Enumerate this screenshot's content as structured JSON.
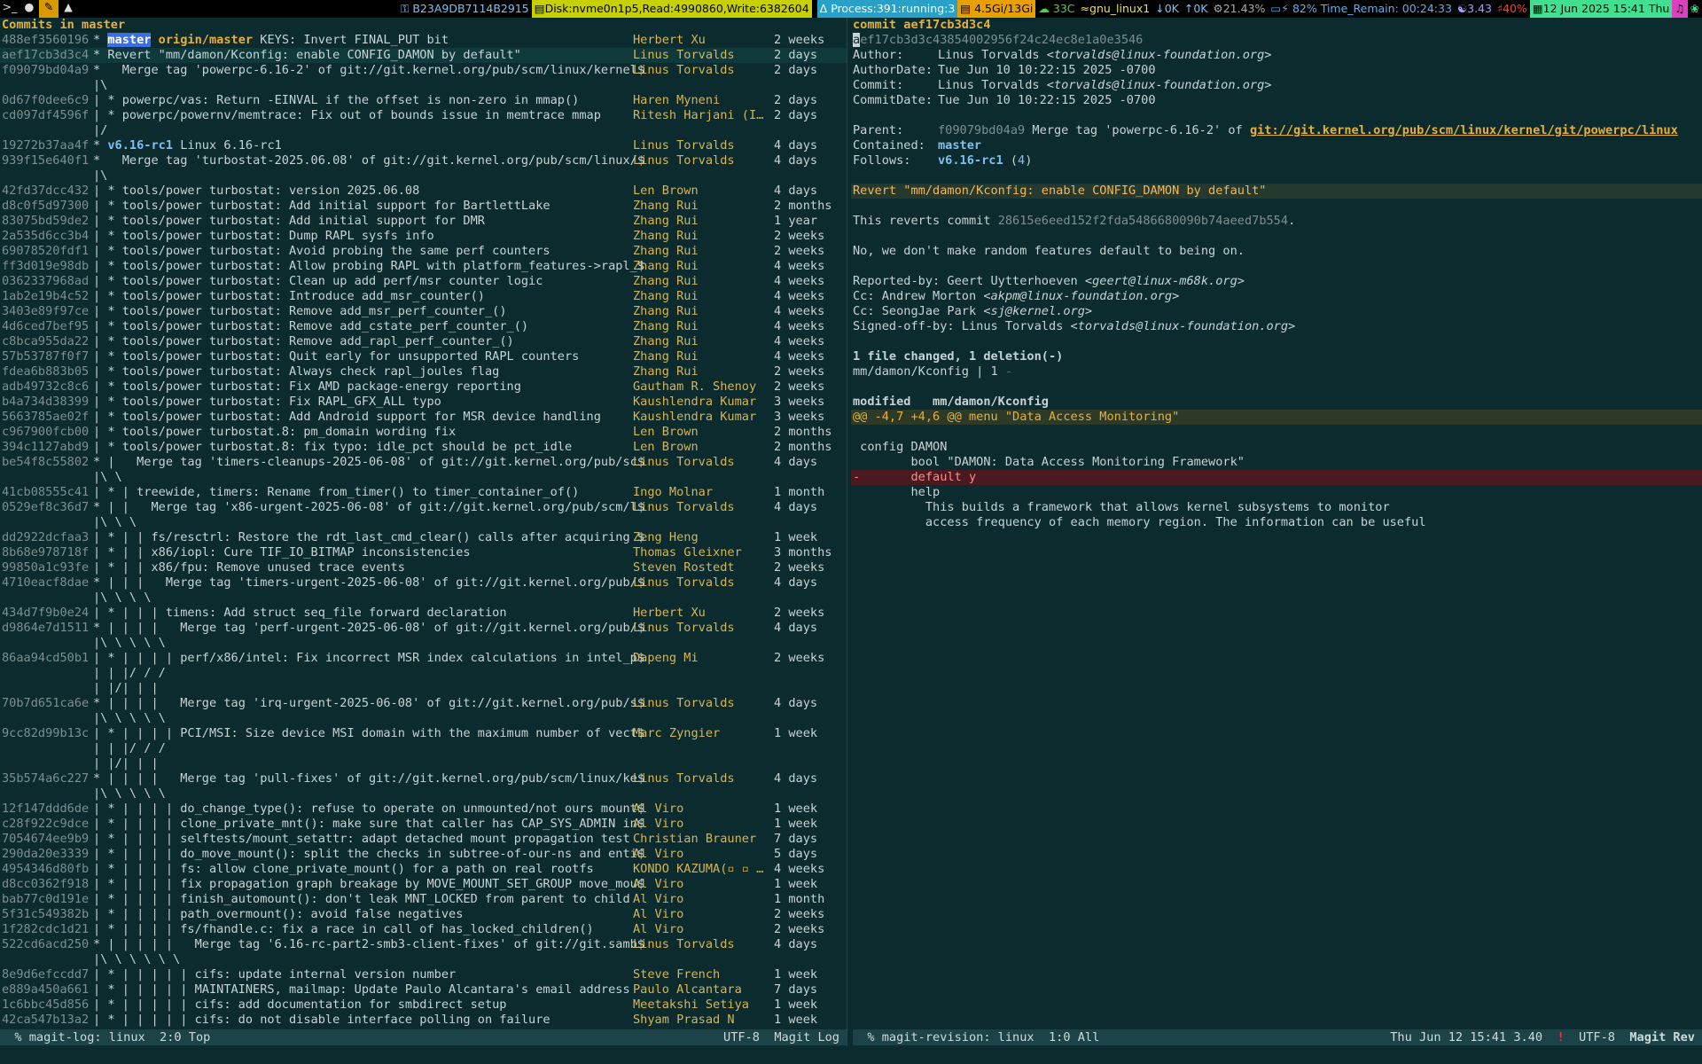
{
  "topbar": {
    "workspace_icons": [
      "terminal-icon",
      "circle-icon",
      "brush-icon",
      "penguin-icon"
    ],
    "key_id": "B23A9DB7114B2915",
    "disk": "Disk:nvme0n1p5,Read:4990860,Write:6382604",
    "process": "Process:391:running:3",
    "mem": "4.5Gi/13Gi",
    "temp": "33C",
    "wifi": "gnu_linux1",
    "net_down": "0K",
    "net_up": "0K",
    "cpu": "21.43%",
    "battery": "82% Time_Remain: 00:24:33",
    "load": "3.43",
    "volume": "40%",
    "clock": "12 Jun 2025 15:41 Thu"
  },
  "left": {
    "title": "Commits in master",
    "rows": [
      {
        "hash": "488ef3560196",
        "graph": "* ",
        "refs": [
          {
            "text": "master",
            "kind": "local-hl"
          },
          {
            "text": "origin/master",
            "kind": "remote"
          }
        ],
        "msg": "KEYS: Invert FINAL_PUT bit",
        "author": "Herbert Xu",
        "date": "2 weeks"
      },
      {
        "hash": "aef17cb3d3c4",
        "graph": "* ",
        "msg": "Revert \"mm/damon/Kconfig: enable CONFIG_DAMON by default\"",
        "author": "Linus Torvalds",
        "date": "2 days",
        "sel": true
      },
      {
        "hash": "f09079bd04a9",
        "graph": "*   ",
        "msg": "Merge tag 'powerpc-6.16-2' of git://git.kernel.org/pub/scm/linux/kernel$",
        "author": "Linus Torvalds",
        "date": "2 days"
      },
      {
        "hash": "",
        "graph": "|\\",
        "msg": "",
        "author": "",
        "date": ""
      },
      {
        "hash": "0d67f0dee6c9",
        "graph": "| * ",
        "msg": "powerpc/vas: Return -EINVAL if the offset is non-zero in mmap()",
        "author": "Haren Myneni",
        "date": "2 days"
      },
      {
        "hash": "cd097df4596f",
        "graph": "| * ",
        "msg": "powerpc/powernv/memtrace: Fix out of bounds issue in memtrace mmap",
        "author": "Ritesh Harjani (I…",
        "date": "2 days"
      },
      {
        "hash": "",
        "graph": "|/",
        "msg": "",
        "author": "",
        "date": ""
      },
      {
        "hash": "19272b37aa4f",
        "graph": "* ",
        "refs": [
          {
            "text": "v6.16-rc1",
            "kind": "tag"
          }
        ],
        "msg": "Linux 6.16-rc1",
        "author": "Linus Torvalds",
        "date": "4 days"
      },
      {
        "hash": "939f15e640f1",
        "graph": "*   ",
        "msg": "Merge tag 'turbostat-2025.06.08' of git://git.kernel.org/pub/scm/linux/$",
        "author": "Linus Torvalds",
        "date": "4 days"
      },
      {
        "hash": "",
        "graph": "|\\",
        "msg": "",
        "author": "",
        "date": ""
      },
      {
        "hash": "42fd37dcc432",
        "graph": "| * ",
        "msg": "tools/power turbostat: version 2025.06.08",
        "author": "Len Brown",
        "date": "4 days"
      },
      {
        "hash": "d8c0f5d97300",
        "graph": "| * ",
        "msg": "tools/power turbostat: Add initial support for BartlettLake",
        "author": "Zhang Rui",
        "date": "2 months"
      },
      {
        "hash": "83075bd59de2",
        "graph": "| * ",
        "msg": "tools/power turbostat: Add initial support for DMR",
        "author": "Zhang Rui",
        "date": "1 year"
      },
      {
        "hash": "2a535d6cc3b4",
        "graph": "| * ",
        "msg": "tools/power turbostat: Dump RAPL sysfs info",
        "author": "Zhang Rui",
        "date": "2 weeks"
      },
      {
        "hash": "69078520fdf1",
        "graph": "| * ",
        "msg": "tools/power turbostat: Avoid probing the same perf counters",
        "author": "Zhang Rui",
        "date": "2 weeks"
      },
      {
        "hash": "ff3d019e98db",
        "graph": "| * ",
        "msg": "tools/power turbostat: Allow probing RAPL with platform_features->rapl_$",
        "author": "Zhang Rui",
        "date": "4 weeks"
      },
      {
        "hash": "0362337968ad",
        "graph": "| * ",
        "msg": "tools/power turbostat: Clean up add perf/msr counter logic",
        "author": "Zhang Rui",
        "date": "4 weeks"
      },
      {
        "hash": "1ab2e19b4c52",
        "graph": "| * ",
        "msg": "tools/power turbostat: Introduce add_msr_counter()",
        "author": "Zhang Rui",
        "date": "4 weeks"
      },
      {
        "hash": "3403e89f97ce",
        "graph": "| * ",
        "msg": "tools/power turbostat: Remove add_msr_perf_counter_()",
        "author": "Zhang Rui",
        "date": "4 weeks"
      },
      {
        "hash": "4d6ced7bef95",
        "graph": "| * ",
        "msg": "tools/power turbostat: Remove add_cstate_perf_counter_()",
        "author": "Zhang Rui",
        "date": "4 weeks"
      },
      {
        "hash": "c8bca955da22",
        "graph": "| * ",
        "msg": "tools/power turbostat: Remove add_rapl_perf_counter_()",
        "author": "Zhang Rui",
        "date": "4 weeks"
      },
      {
        "hash": "57b53787f0f7",
        "graph": "| * ",
        "msg": "tools/power turbostat: Quit early for unsupported RAPL counters",
        "author": "Zhang Rui",
        "date": "4 weeks"
      },
      {
        "hash": "fdea6b883b05",
        "graph": "| * ",
        "msg": "tools/power turbostat: Always check rapl_joules flag",
        "author": "Zhang Rui",
        "date": "2 weeks"
      },
      {
        "hash": "adb49732c8c6",
        "graph": "| * ",
        "msg": "tools/power turbostat: Fix AMD package-energy reporting",
        "author": "Gautham R. Shenoy",
        "date": "2 weeks"
      },
      {
        "hash": "b4a734d38399",
        "graph": "| * ",
        "msg": "tools/power turbostat: Fix RAPL_GFX_ALL typo",
        "author": "Kaushlendra Kumar",
        "date": "3 weeks"
      },
      {
        "hash": "5663785ae02f",
        "graph": "| * ",
        "msg": "tools/power turbostat: Add Android support for MSR device handling",
        "author": "Kaushlendra Kumar",
        "date": "3 weeks"
      },
      {
        "hash": "c967900fcb00",
        "graph": "| * ",
        "msg": "tools/power turbostat.8: pm_domain wording fix",
        "author": "Len Brown",
        "date": "2 months"
      },
      {
        "hash": "394c1127abd9",
        "graph": "| * ",
        "msg": "tools/power turbostat.8: fix typo: idle_pct should be pct_idle",
        "author": "Len Brown",
        "date": "2 months"
      },
      {
        "hash": "be54f8c55802",
        "graph": "* |   ",
        "msg": "Merge tag 'timers-cleanups-2025-06-08' of git://git.kernel.org/pub/sc$",
        "author": "Linus Torvalds",
        "date": "4 days"
      },
      {
        "hash": "",
        "graph": "|\\ \\",
        "msg": "",
        "author": "",
        "date": ""
      },
      {
        "hash": "41cb08555c41",
        "graph": "| * | ",
        "msg": "treewide, timers: Rename from_timer() to timer_container_of()",
        "author": "Ingo Molnar",
        "date": "1 month"
      },
      {
        "hash": "0529ef8c36d7",
        "graph": "* | |   ",
        "msg": "Merge tag 'x86-urgent-2025-06-08' of git://git.kernel.org/pub/scm/l$",
        "author": "Linus Torvalds",
        "date": "4 days"
      },
      {
        "hash": "",
        "graph": "|\\ \\ \\",
        "msg": "",
        "author": "",
        "date": ""
      },
      {
        "hash": "dd2922dcfaa3",
        "graph": "| * | | ",
        "msg": "fs/resctrl: Restore the rdt_last_cmd_clear() calls after acquiring $",
        "author": "Zeng Heng",
        "date": "1 week"
      },
      {
        "hash": "8b68e978718f",
        "graph": "| * | | ",
        "msg": "x86/iopl: Cure TIF_IO_BITMAP inconsistencies",
        "author": "Thomas Gleixner",
        "date": "3 months"
      },
      {
        "hash": "99850a1c93fe",
        "graph": "| * | | ",
        "msg": "x86/fpu: Remove unused trace events",
        "author": "Steven Rostedt",
        "date": "2 weeks"
      },
      {
        "hash": "4710eacf8dae",
        "graph": "* | | |   ",
        "msg": "Merge tag 'timers-urgent-2025-06-08' of git://git.kernel.org/pub/$",
        "author": "Linus Torvalds",
        "date": "4 days"
      },
      {
        "hash": "",
        "graph": "|\\ \\ \\ \\",
        "msg": "",
        "author": "",
        "date": ""
      },
      {
        "hash": "434d7f9b0e24",
        "graph": "| * | | | ",
        "msg": "timens: Add struct seq_file forward declaration",
        "author": "Herbert Xu",
        "date": "2 weeks"
      },
      {
        "hash": "d9864e7d1511",
        "graph": "* | | | |   ",
        "msg": "Merge tag 'perf-urgent-2025-06-08' of git://git.kernel.org/pub/$",
        "author": "Linus Torvalds",
        "date": "4 days"
      },
      {
        "hash": "",
        "graph": "|\\ \\ \\ \\ \\",
        "msg": "",
        "author": "",
        "date": ""
      },
      {
        "hash": "86aa94cd50b1",
        "graph": "| * | | | | ",
        "msg": "perf/x86/intel: Fix incorrect MSR index calculations in intel_p$",
        "author": "Dapeng Mi",
        "date": "2 weeks"
      },
      {
        "hash": "",
        "graph": "| | |/ / /",
        "msg": "",
        "author": "",
        "date": ""
      },
      {
        "hash": "",
        "graph": "| |/| | |",
        "msg": "",
        "author": "",
        "date": ""
      },
      {
        "hash": "70b7d651ca6e",
        "graph": "* | | | |   ",
        "msg": "Merge tag 'irq-urgent-2025-06-08' of git://git.kernel.org/pub/s$",
        "author": "Linus Torvalds",
        "date": "4 days"
      },
      {
        "hash": "",
        "graph": "|\\ \\ \\ \\ \\",
        "msg": "",
        "author": "",
        "date": ""
      },
      {
        "hash": "9cc82d99b13c",
        "graph": "| * | | | | ",
        "msg": "PCI/MSI: Size device MSI domain with the maximum number of vect$",
        "author": "Marc Zyngier",
        "date": "1 week"
      },
      {
        "hash": "",
        "graph": "| | |/ / /",
        "msg": "",
        "author": "",
        "date": ""
      },
      {
        "hash": "",
        "graph": "| |/| | |",
        "msg": "",
        "author": "",
        "date": ""
      },
      {
        "hash": "35b574a6c227",
        "graph": "* | | | |   ",
        "msg": "Merge tag 'pull-fixes' of git://git.kernel.org/pub/scm/linux/ke$",
        "author": "Linus Torvalds",
        "date": "4 days"
      },
      {
        "hash": "",
        "graph": "|\\ \\ \\ \\ \\",
        "msg": "",
        "author": "",
        "date": ""
      },
      {
        "hash": "12f147ddd6de",
        "graph": "| * | | | | ",
        "msg": "do_change_type(): refuse to operate on unmounted/not ours mount$",
        "author": "Al Viro",
        "date": "1 week"
      },
      {
        "hash": "c28f922c9dce",
        "graph": "| * | | | | ",
        "msg": "clone_private_mnt(): make sure that caller has CAP_SYS_ADMIN in$",
        "author": "Al Viro",
        "date": "1 week"
      },
      {
        "hash": "7054674ee9b9",
        "graph": "| * | | | | ",
        "msg": "selftests/mount_setattr: adapt detached mount propagation test",
        "author": "Christian Brauner",
        "date": "7 days"
      },
      {
        "hash": "290da20e3339",
        "graph": "| * | | | | ",
        "msg": "do_move_mount(): split the checks in subtree-of-our-ns and enti$",
        "author": "Al Viro",
        "date": "5 days"
      },
      {
        "hash": "4954346d80fb",
        "graph": "| * | | | | ",
        "msg": "fs: allow clone_private_mount() for a path on real rootfs",
        "author": "KONDO KAZUMA(▫ ▫ …",
        "date": "4 weeks"
      },
      {
        "hash": "d8cc0362f918",
        "graph": "| * | | | | ",
        "msg": "fix propagation graph breakage by MOVE_MOUNT_SET_GROUP move_mou$",
        "author": "Al Viro",
        "date": "1 week"
      },
      {
        "hash": "bab77c0d191e",
        "graph": "| * | | | | ",
        "msg": "finish_automount(): don't leak MNT_LOCKED from parent to child",
        "author": "Al Viro",
        "date": "1 month"
      },
      {
        "hash": "5f31c549382b",
        "graph": "| * | | | | ",
        "msg": "path_overmount(): avoid false negatives",
        "author": "Al Viro",
        "date": "2 weeks"
      },
      {
        "hash": "1f282cdc1d21",
        "graph": "| * | | | | ",
        "msg": "fs/fhandle.c: fix a race in call of has_locked_children()",
        "author": "Al Viro",
        "date": "2 weeks"
      },
      {
        "hash": "522cd6acd250",
        "graph": "* | | | | |   ",
        "msg": "Merge tag '6.16-rc-part2-smb3-client-fixes' of git://git.samb$",
        "author": "Linus Torvalds",
        "date": "4 days"
      },
      {
        "hash": "",
        "graph": "|\\ \\ \\ \\ \\ \\",
        "msg": "",
        "author": "",
        "date": ""
      },
      {
        "hash": "8e9d6efccdd7",
        "graph": "| * | | | | | ",
        "msg": "cifs: update internal version number",
        "author": "Steve French",
        "date": "1 week"
      },
      {
        "hash": "e889a450a661",
        "graph": "| * | | | | | ",
        "msg": "MAINTAINERS, mailmap: Update Paulo Alcantara's email address",
        "author": "Paulo Alcantara",
        "date": "7 days"
      },
      {
        "hash": "1c6bbc45d856",
        "graph": "| * | | | | | ",
        "msg": "cifs: add documentation for smbdirect setup",
        "author": "Meetakshi Setiya",
        "date": "1 week"
      },
      {
        "hash": "42ca547b13a2",
        "graph": "| * | | | | | ",
        "msg": "cifs: do not disable interface polling on failure",
        "author": "Shyam Prasad N",
        "date": "1 week"
      }
    ],
    "modeline": {
      "left": "  % magit-log: linux  2:0 Top",
      "right": "UTF-8  Magit Log"
    }
  },
  "right": {
    "title": "commit aef17cb3d3c4",
    "full_hash": "aef17cb3d3c43854002956f24c24ec8e1a0e3546",
    "author_label": "Author:",
    "author": "Linus Torvalds",
    "author_email": "<torvalds@linux-foundation.org>",
    "author_date_label": "AuthorDate:",
    "author_date": "Tue Jun 10 10:22:15 2025 -0700",
    "committer_label": "Commit:",
    "committer": "Linus Torvalds",
    "committer_email": "<torvalds@linux-foundation.org>",
    "commit_date_label": "CommitDate:",
    "commit_date": "Tue Jun 10 10:22:15 2025 -0700",
    "parent_label": "Parent:",
    "parent_hash": "f09079bd04a9",
    "parent_msg": "Merge tag 'powerpc-6.16-2' of",
    "parent_link": "git://git.kernel.org/pub/scm/linux/kernel/git/powerpc/linux",
    "contained_label": "Contained:",
    "contained": "master",
    "follows_label": "Follows:",
    "follows_tag": "v6.16-rc1",
    "follows_n": "4",
    "summary": "Revert \"mm/damon/Kconfig: enable CONFIG_DAMON by default\"",
    "body1_a": "This reverts commit",
    "body1_hash": "28615e6eed152f2fda5486680090b74aeed7b554",
    "body1_b": ".",
    "body2": "No, we don't make random features default to being on.",
    "reported_by": "Reported-by: Geert Uytterhoeven ",
    "reported_email": "<geert@linux-m68k.org>",
    "cc1": "Cc: Andrew Morton ",
    "cc1_email": "<akpm@linux-foundation.org>",
    "cc2": "Cc: SeongJae Park ",
    "cc2_email": "<sj@kernel.org>",
    "signed": "Signed-off-by: Linus Torvalds ",
    "signed_email": "<torvalds@linux-foundation.org>",
    "stat": "1 file changed, 1 deletion(-)",
    "stat_file": "mm/damon/Kconfig | 1 ",
    "stat_minus": "-",
    "modified_label": "modified   mm/damon/Kconfig",
    "hunk": "@@ -4,7 +4,6 @@ menu \"Data Access Monitoring\"",
    "diff_lines": [
      {
        "t": "ctx",
        "text": " config DAMON"
      },
      {
        "t": "ctx",
        "text": "        bool \"DAMON: Data Access Monitoring Framework\""
      },
      {
        "t": "del",
        "text": "-       default y"
      },
      {
        "t": "ctx",
        "text": "        help"
      },
      {
        "t": "ctx",
        "text": "          This builds a framework that allows kernel subsystems to monitor"
      },
      {
        "t": "ctx",
        "text": "          access frequency of each memory region. The information can be useful"
      }
    ],
    "modeline": {
      "left": "  % magit-revision: linux  1:0 All",
      "clock": "Thu Jun 12 15:41 3.40",
      "bang": "!",
      "enc": "UTF-8",
      "mode": "Magit Rev"
    }
  }
}
